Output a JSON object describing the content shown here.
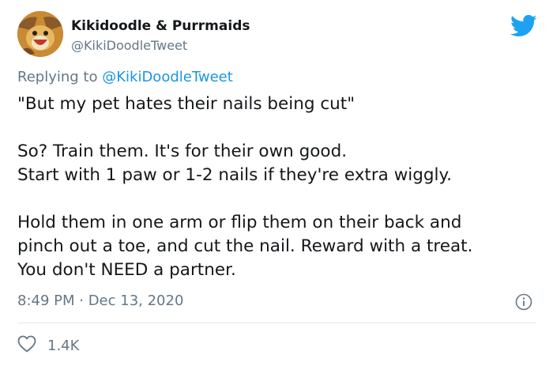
{
  "tweet": {
    "display_name": "Kikidoodle & Purrmaids",
    "handle": "@KikiDoodleTweet",
    "replying_prefix": "Replying to",
    "replying_to": "@KikiDoodleTweet",
    "lines": [
      "\"But my pet hates their nails being cut\"",
      "So? Train them. It's for their own good.",
      "Start with 1 paw or 1-2 nails if they're extra wiggly.",
      "Hold them in one arm or flip them on their back and",
      "pinch out a toe, and cut the nail. Reward with a treat.",
      "You don't NEED a partner."
    ],
    "timestamp": "8:49 PM · Dec 13, 2020",
    "like_count": "1.4K"
  },
  "colors": {
    "brand_blue": "#1da1f2",
    "mention_blue": "#1b95e0",
    "secondary_text": "#657786",
    "primary_text": "#14171a"
  },
  "icons": {
    "avatar": "cartoon-avatar",
    "logo": "twitter-bird-icon",
    "info": "info-icon",
    "like": "heart-outline-icon"
  }
}
